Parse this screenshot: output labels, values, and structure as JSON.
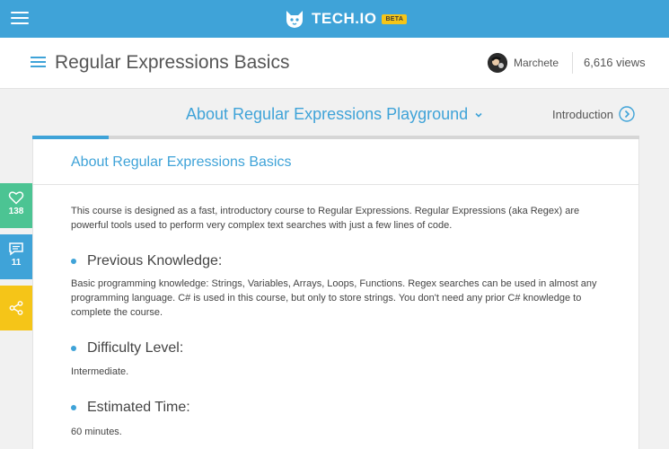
{
  "brand": {
    "name": "TECH.IO",
    "badge": "BETA"
  },
  "course": {
    "title": "Regular Expressions Basics",
    "author": "Marchete",
    "views": "6,616 views"
  },
  "lesson_nav": {
    "current": "About Regular Expressions Playground",
    "next_label": "Introduction"
  },
  "progress": {
    "fraction": 0.125
  },
  "side_actions": {
    "likes": "138",
    "comments": "11"
  },
  "content": {
    "heading": "About Regular Expressions Basics",
    "intro": "This course is designed as a fast, introductory course to Regular Expressions. Regular Expressions (aka Regex) are powerful tools used to perform very complex text searches with just a few lines of code.",
    "sections": [
      {
        "title": "Previous Knowledge:",
        "body": "Basic programming knowledge: Strings, Variables, Arrays, Loops, Functions. Regex searches can be used in almost any programming language. C# is used in this course, but only to store strings. You don't need any prior C# knowledge to complete the course."
      },
      {
        "title": "Difficulty Level:",
        "body": "Intermediate."
      },
      {
        "title": "Estimated Time:",
        "body": "60 minutes."
      }
    ]
  },
  "colors": {
    "accent": "#3fa3d8",
    "like": "#4cc493",
    "share": "#f5c518"
  },
  "icons": {
    "menu": "hamburger-icon",
    "like": "heart-icon",
    "comment": "comment-icon",
    "share": "share-icon",
    "next": "chevron-circle-right-icon"
  }
}
